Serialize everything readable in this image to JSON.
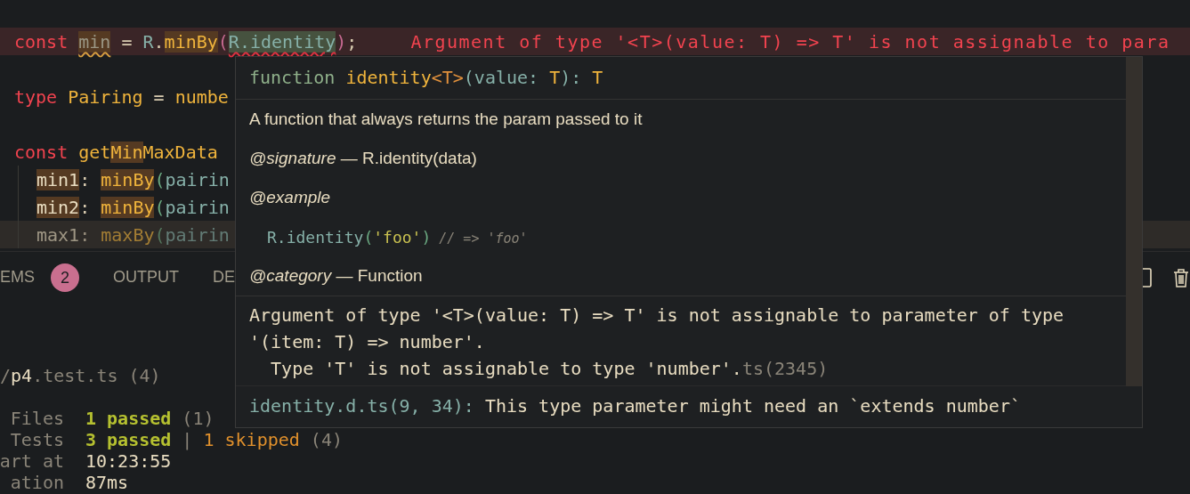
{
  "editor": {
    "lines": [
      {
        "current": false,
        "indent": false,
        "error": "Argument of type '<T>(value: T) => T' is not assignable to para",
        "tokens": [
          {
            "text": "const ",
            "kind": "keyword",
            "highlight": false,
            "warning": false,
            "invalid": false
          },
          {
            "text": "min",
            "kind": "unused",
            "highlight": true,
            "warning": true,
            "invalid": false
          },
          {
            "text": " = ",
            "kind": "plain",
            "highlight": false,
            "warning": false,
            "invalid": false
          },
          {
            "text": "R",
            "kind": "object",
            "highlight": false,
            "warning": false,
            "invalid": false
          },
          {
            "text": ".",
            "kind": "plain",
            "highlight": false,
            "warning": false,
            "invalid": false
          },
          {
            "text": "minBy",
            "kind": "function",
            "highlight": true,
            "warning": false,
            "invalid": false
          },
          {
            "text": "(",
            "kind": "bracket1",
            "highlight": false,
            "warning": false,
            "invalid": false
          },
          {
            "text": "R.identity",
            "kind": "object",
            "highlight": true,
            "warning": false,
            "invalid": true
          },
          {
            "text": ")",
            "kind": "bracket1",
            "highlight": false,
            "warning": false,
            "invalid": false
          },
          {
            "text": ";",
            "kind": "plain",
            "highlight": false,
            "warning": false,
            "invalid": false
          }
        ]
      },
      {
        "current": false,
        "indent": false
      },
      {
        "current": false,
        "indent": false,
        "tokens": [
          {
            "text": "type ",
            "kind": "keyword",
            "highlight": false,
            "warning": false,
            "invalid": false
          },
          {
            "text": "Pairing",
            "kind": "function",
            "highlight": false,
            "warning": false,
            "invalid": false
          },
          {
            "text": " = ",
            "kind": "plain",
            "highlight": false,
            "warning": false,
            "invalid": false
          },
          {
            "text": "numbe",
            "kind": "function",
            "highlight": false,
            "warning": false,
            "invalid": false
          }
        ]
      },
      {
        "current": false,
        "indent": false
      },
      {
        "current": false,
        "indent": false,
        "tokens": [
          {
            "text": "const ",
            "kind": "keyword",
            "highlight": false,
            "warning": false,
            "invalid": false
          },
          {
            "text": "get",
            "kind": "function",
            "highlight": false,
            "warning": false,
            "invalid": false
          },
          {
            "text": "Min",
            "kind": "function",
            "highlight": true,
            "warning": false,
            "invalid": false
          },
          {
            "text": "MaxData",
            "kind": "function",
            "highlight": false,
            "warning": false,
            "invalid": false
          }
        ]
      },
      {
        "current": false,
        "indent": true,
        "tokens": [
          {
            "text": "min1",
            "kind": "property",
            "highlight": true,
            "warning": false,
            "invalid": false
          },
          {
            "text": ": ",
            "kind": "plain",
            "highlight": false,
            "warning": false,
            "invalid": false
          },
          {
            "text": "minBy",
            "kind": "function",
            "highlight": true,
            "warning": false,
            "invalid": false
          },
          {
            "text": "(",
            "kind": "bracket2",
            "highlight": false,
            "warning": false,
            "invalid": false
          },
          {
            "text": "pairin",
            "kind": "object",
            "highlight": false,
            "warning": false,
            "invalid": false
          }
        ]
      },
      {
        "current": false,
        "indent": true,
        "tokens": [
          {
            "text": "min2",
            "kind": "property",
            "highlight": true,
            "warning": false,
            "invalid": false
          },
          {
            "text": ": ",
            "kind": "plain",
            "highlight": false,
            "warning": false,
            "invalid": false
          },
          {
            "text": "minBy",
            "kind": "function",
            "highlight": true,
            "warning": false,
            "invalid": false
          },
          {
            "text": "(",
            "kind": "bracket2",
            "highlight": false,
            "warning": false,
            "invalid": false
          },
          {
            "text": "pairin",
            "kind": "object",
            "highlight": false,
            "warning": false,
            "invalid": false
          }
        ]
      },
      {
        "current": true,
        "indent": true,
        "tokens": [
          {
            "text": "max1",
            "kind": "property",
            "highlight": false,
            "warning": false,
            "invalid": false
          },
          {
            "text": ": ",
            "kind": "plain",
            "highlight": false,
            "warning": false,
            "invalid": false
          },
          {
            "text": "maxBy",
            "kind": "function",
            "highlight": false,
            "warning": false,
            "invalid": false
          },
          {
            "text": "(",
            "kind": "bracket2",
            "highlight": false,
            "warning": false,
            "invalid": false
          },
          {
            "text": "pairin",
            "kind": "object",
            "highlight": false,
            "warning": false,
            "invalid": false
          }
        ]
      }
    ]
  },
  "hover": {
    "signature": [
      {
        "text": "function ",
        "kind": "keyword2"
      },
      {
        "text": "identity",
        "kind": "function"
      },
      {
        "text": "<T>",
        "kind": "bracket3"
      },
      {
        "text": "(value: ",
        "kind": "object"
      },
      {
        "text": "T",
        "kind": "function"
      },
      {
        "text": "): ",
        "kind": "object"
      },
      {
        "text": "T",
        "kind": "function"
      }
    ],
    "doc": [
      {
        "kind": "text",
        "text": "A function that always returns the param passed to it"
      },
      {
        "kind": "text",
        "text": "*@signature* — R.identity(data)"
      },
      {
        "kind": "text",
        "text": "*@example*"
      },
      {
        "kind": "code",
        "tokens": [
          {
            "text": "R.identity",
            "kind": "object"
          },
          {
            "text": "(",
            "kind": "bracket2"
          },
          {
            "text": "'foo'",
            "kind": "string"
          },
          {
            "text": ")",
            "kind": "bracket2"
          },
          {
            "text": " // => 'foo'",
            "kind": "comment"
          }
        ]
      },
      {
        "kind": "text",
        "text": "*@category* — Function"
      }
    ],
    "error": {
      "lines": [
        "Argument of type '<T>(value: T) => T' is not assignable to parameter of type",
        "'(item: T) => number'.",
        "  Type 'T' is not assignable to type 'number'."
      ],
      "code": "ts(2345)"
    },
    "related": {
      "location": "identity.d.ts(9, 34):",
      "text": "This type parameter might need an `extends number`"
    }
  },
  "panel": {
    "tabs": [
      {
        "label": "EMS",
        "badge": "2",
        "selected": false
      },
      {
        "label": "OUTPUT",
        "selected": false
      },
      {
        "label": "DE",
        "selected": false
      }
    ],
    "terminal": [
      {
        "segments": [
          {
            "text": "/",
            "kind": "dim"
          },
          {
            "text": "p4",
            "kind": "bright"
          },
          {
            "text": ".test.ts (4)",
            "kind": "dim"
          }
        ]
      },
      {
        "label": "Files",
        "segments": [
          {
            "text": "1 passed",
            "kind": "pass"
          },
          {
            "text": " (1)",
            "kind": "dim"
          }
        ]
      },
      {
        "label": "Tests",
        "segments": [
          {
            "text": "3 passed",
            "kind": "pass"
          },
          {
            "text": " | ",
            "kind": "dim"
          },
          {
            "text": "1 skipped",
            "kind": "skip"
          },
          {
            "text": " (4)",
            "kind": "dim"
          }
        ]
      },
      {
        "label": "art at",
        "segments": [
          {
            "text": "10:23:55",
            "kind": "bright"
          }
        ]
      },
      {
        "label": "ation",
        "segments": [
          {
            "text": "87ms",
            "kind": "bright"
          }
        ]
      }
    ]
  }
}
